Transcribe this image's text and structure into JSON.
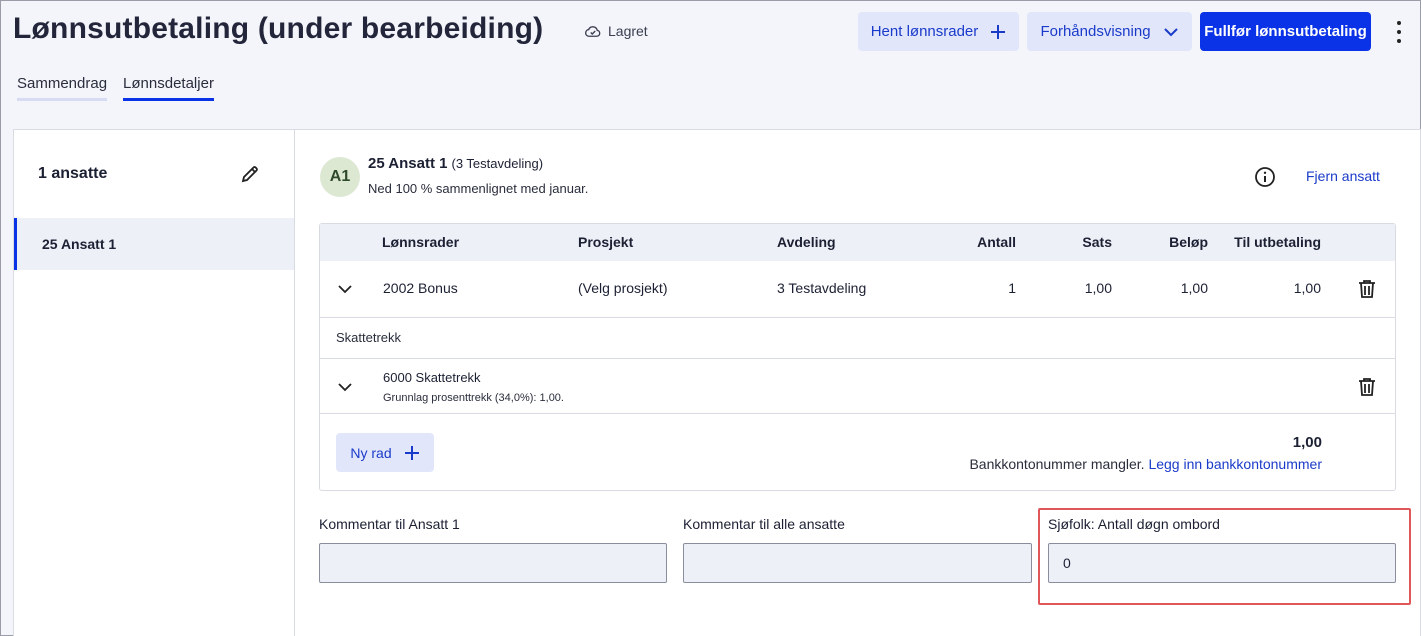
{
  "header": {
    "title": "Lønnsutbetaling (under bearbeiding)",
    "saved_status": "Lagret",
    "fetch_rows_label": "Hent lønnsrader",
    "preview_label": "Forhåndsvisning",
    "finish_label": "Fullfør lønnsutbetaling"
  },
  "tabs": [
    {
      "label": "Sammendrag",
      "active": false
    },
    {
      "label": "Lønnsdetaljer",
      "active": true
    }
  ],
  "sidebar": {
    "count_label": "1 ansatte",
    "employees": [
      {
        "label": "25 Ansatt 1",
        "selected": true
      }
    ]
  },
  "employee": {
    "initials": "A1",
    "name": "25 Ansatt 1",
    "department": "(3 Testavdeling)",
    "subtitle": "Ned 100 % sammenlignet med januar.",
    "remove_label": "Fjern ansatt"
  },
  "table": {
    "columns": [
      "Lønnsrader",
      "Prosjekt",
      "Avdeling",
      "Antall",
      "Sats",
      "Beløp",
      "Til utbetaling"
    ],
    "rows": [
      {
        "wage_type": "2002 Bonus",
        "project": "(Velg prosjekt)",
        "department": "3 Testavdeling",
        "quantity": "1",
        "rate": "1,00",
        "amount": "1,00",
        "payout": "1,00"
      }
    ],
    "tax_section_label": "Skattetrekk",
    "tax_row": {
      "title": "6000 Skattetrekk",
      "subtitle": "Grunnlag prosenttrekk (34,0%): 1,00."
    },
    "new_row_label": "Ny rad",
    "total": "1,00",
    "bank_missing": "Bankkontonummer mangler.",
    "bank_link": "Legg inn bankkontonummer"
  },
  "fields": {
    "comment_employee_label": "Kommentar til Ansatt 1",
    "comment_employee_value": "",
    "comment_all_label": "Kommentar til alle ansatte",
    "comment_all_value": "",
    "seafarer_label": "Sjøfolk: Antall døgn ombord",
    "seafarer_value": "0"
  },
  "colors": {
    "primary": "#0a32e6",
    "light_button": "#e1e6fb",
    "highlight": "#e0575a"
  }
}
